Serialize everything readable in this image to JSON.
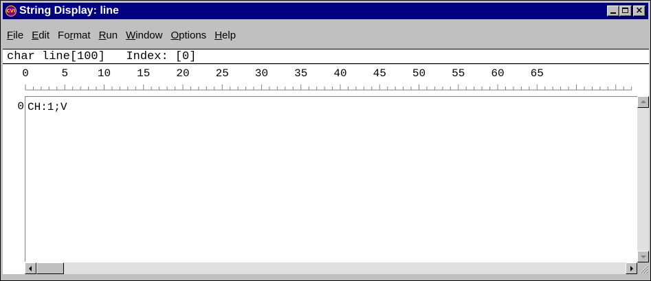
{
  "window": {
    "title": "String Display: line",
    "app_icon_label": "CVI",
    "titlebar_color": "#000080",
    "controls": [
      "minimize-icon",
      "maximize-icon",
      "close-icon"
    ]
  },
  "menu": {
    "items": [
      {
        "mnemonic": "F",
        "rest": "ile"
      },
      {
        "mnemonic": "E",
        "rest": "dit"
      },
      {
        "pre": "Fo",
        "mnemonic": "r",
        "rest": "mat"
      },
      {
        "mnemonic": "R",
        "rest": "un"
      },
      {
        "mnemonic": "W",
        "rest": "indow"
      },
      {
        "mnemonic": "O",
        "rest": "ptions"
      },
      {
        "mnemonic": "H",
        "rest": "elp"
      }
    ]
  },
  "info": {
    "declaration": "char line[100]",
    "index_label": "Index:",
    "index_value": "[0]"
  },
  "ruler": {
    "labels": [
      "0",
      "5",
      "10",
      "15",
      "20",
      "25",
      "30",
      "35",
      "40",
      "45",
      "50",
      "55",
      "60",
      "65"
    ]
  },
  "editor": {
    "line_number": "0",
    "text": "CH:1;V"
  }
}
